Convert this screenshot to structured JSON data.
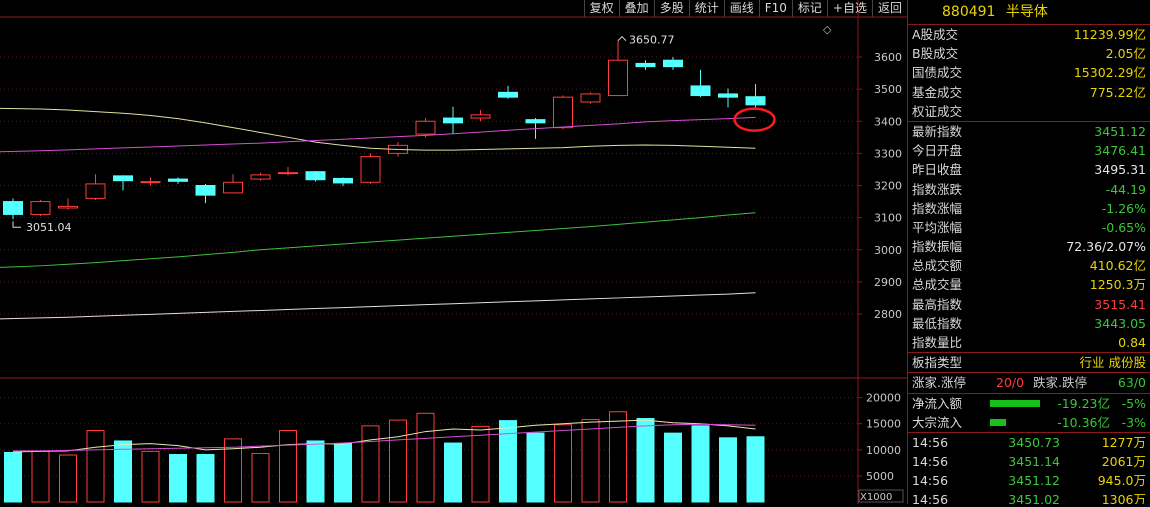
{
  "toolbar": {
    "buttons": [
      "复权",
      "叠加",
      "多股",
      "统计",
      "画线",
      "F10",
      "标记",
      "+自选",
      "返回"
    ]
  },
  "markers": {
    "high_label": "3650.77",
    "low_label": "3051.04",
    "diamond": "◇"
  },
  "price_axis": {
    "ticks": [
      "3600",
      "3500",
      "3400",
      "3300",
      "3200",
      "3100",
      "3000",
      "2900",
      "2800"
    ]
  },
  "volume_axis": {
    "ticks": [
      "20000",
      "15000",
      "10000",
      "5000"
    ],
    "unit": "X1000"
  },
  "colors": {
    "up": "#ff3c3c",
    "down": "#54ffff",
    "ma5": "#e8e8b0",
    "ma10": "#d24fd2",
    "ma20": "#e0e0a0",
    "ma60": "#3fc13f",
    "ma120": "#e0e0e0",
    "accent_yellow": "#e8d500",
    "gain_red": "#ff3c3c",
    "loss_green": "#38c838",
    "circle": "#ff1a1a"
  },
  "chart_data": {
    "type": "candlestick",
    "price_ylim": [
      2750,
      3650
    ],
    "volume_ylim": [
      0,
      23000
    ],
    "candles": [
      {
        "o": 3150,
        "c": 3110,
        "h": 3160,
        "l": 3095,
        "v": 9500
      },
      {
        "o": 3110,
        "c": 3150,
        "h": 3155,
        "l": 3105,
        "v": 9700
      },
      {
        "o": 3130,
        "c": 3135,
        "h": 3160,
        "l": 3125,
        "v": 9000
      },
      {
        "o": 3160,
        "c": 3205,
        "h": 3235,
        "l": 3155,
        "v": 13700
      },
      {
        "o": 3230,
        "c": 3215,
        "h": 3232,
        "l": 3185,
        "v": 11700
      },
      {
        "o": 3210,
        "c": 3212,
        "h": 3225,
        "l": 3200,
        "v": 9700
      },
      {
        "o": 3220,
        "c": 3213,
        "h": 3225,
        "l": 3205,
        "v": 9100
      },
      {
        "o": 3200,
        "c": 3170,
        "h": 3205,
        "l": 3145,
        "v": 9100
      },
      {
        "o": 3177,
        "c": 3210,
        "h": 3235,
        "l": 3175,
        "v": 12100
      },
      {
        "o": 3220,
        "c": 3233,
        "h": 3240,
        "l": 3215,
        "v": 9300
      },
      {
        "o": 3237,
        "c": 3240,
        "h": 3258,
        "l": 3232,
        "v": 13700
      },
      {
        "o": 3243,
        "c": 3218,
        "h": 3245,
        "l": 3212,
        "v": 11700
      },
      {
        "o": 3222,
        "c": 3208,
        "h": 3225,
        "l": 3198,
        "v": 11200
      },
      {
        "o": 3210,
        "c": 3290,
        "h": 3300,
        "l": 3205,
        "v": 14600
      },
      {
        "o": 3300,
        "c": 3325,
        "h": 3335,
        "l": 3290,
        "v": 15700
      },
      {
        "o": 3360,
        "c": 3400,
        "h": 3410,
        "l": 3350,
        "v": 17000
      },
      {
        "o": 3410,
        "c": 3395,
        "h": 3445,
        "l": 3360,
        "v": 11300
      },
      {
        "o": 3410,
        "c": 3420,
        "h": 3435,
        "l": 3400,
        "v": 14500
      },
      {
        "o": 3490,
        "c": 3475,
        "h": 3510,
        "l": 3470,
        "v": 15600
      },
      {
        "o": 3405,
        "c": 3395,
        "h": 3410,
        "l": 3345,
        "v": 13200
      },
      {
        "o": 3380,
        "c": 3475,
        "h": 3480,
        "l": 3375,
        "v": 14800
      },
      {
        "o": 3460,
        "c": 3485,
        "h": 3490,
        "l": 3455,
        "v": 15800
      },
      {
        "o": 3480,
        "c": 3590,
        "h": 3650.77,
        "l": 3478,
        "v": 17300
      },
      {
        "o": 3580,
        "c": 3570,
        "h": 3590,
        "l": 3560,
        "v": 16000
      },
      {
        "o": 3590,
        "c": 3570,
        "h": 3600,
        "l": 3560,
        "v": 13200
      },
      {
        "o": 3510,
        "c": 3480,
        "h": 3560,
        "l": 3475,
        "v": 14600
      },
      {
        "o": 3485,
        "c": 3475,
        "h": 3502,
        "l": 3443,
        "v": 12300
      },
      {
        "o": 3476.41,
        "c": 3451.12,
        "h": 3515.41,
        "l": 3443.05,
        "v": 12500
      }
    ],
    "ma_lines": [
      {
        "points": [
          3440,
          3438,
          3435,
          3430,
          3425,
          3418,
          3408,
          3395,
          3380,
          3365,
          3350,
          3335,
          3325,
          3316,
          3312,
          3310,
          3310,
          3312,
          3314,
          3316,
          3318,
          3322,
          3325,
          3326,
          3325,
          3322,
          3319,
          3316
        ]
      },
      {
        "points": [
          3305,
          3308,
          3311,
          3314,
          3317,
          3320,
          3323,
          3326,
          3329,
          3332,
          3336,
          3340,
          3344,
          3348,
          3352,
          3356,
          3361,
          3366,
          3372,
          3377,
          3382,
          3387,
          3392,
          3398,
          3402,
          3405,
          3408,
          3412
        ]
      },
      {
        "points": [
          2945,
          2950,
          2955,
          2960,
          2966,
          2972,
          2978,
          2985,
          2992,
          3000,
          3006,
          3012,
          3018,
          3024,
          3030,
          3036,
          3042,
          3048,
          3054,
          3060,
          3066,
          3072,
          3079,
          3086,
          3093,
          3100,
          3108,
          3115
        ]
      },
      {
        "points": [
          2785,
          2788,
          2790,
          2793,
          2796,
          2799,
          2802,
          2805,
          2808,
          2811,
          2814,
          2817,
          2820,
          2823,
          2826,
          2829,
          2832,
          2835,
          2838,
          2841,
          2844,
          2847,
          2850,
          2853,
          2856,
          2859,
          2862,
          2866
        ]
      }
    ],
    "vol_ma_lines": [
      {
        "points": [
          9600,
          9700,
          9800,
          10500,
          11000,
          11200,
          10800,
          10000,
          10200,
          10500,
          11000,
          11200,
          11100,
          11900,
          12500,
          13500,
          14000,
          13800,
          14200,
          14700,
          15000,
          15300,
          15500,
          15700,
          15200,
          15000,
          14600,
          14000
        ]
      },
      {
        "points": [
          9800,
          9800,
          9900,
          10000,
          10100,
          10200,
          10300,
          10400,
          10500,
          10700,
          10900,
          11100,
          11300,
          11600,
          11900,
          12200,
          12500,
          12800,
          13100,
          13400,
          13700,
          14000,
          14300,
          14600,
          14800,
          14900,
          14800,
          14700
        ]
      }
    ]
  },
  "panel": {
    "code": "880491",
    "name": "半导体",
    "rows1": [
      {
        "label": "A股成交",
        "value": "11239.99亿",
        "cls": "yellow"
      },
      {
        "label": "B股成交",
        "value": "2.05亿",
        "cls": "yellow"
      },
      {
        "label": "国债成交",
        "value": "15302.29亿",
        "cls": "yellow"
      },
      {
        "label": "基金成交",
        "value": "775.22亿",
        "cls": "yellow"
      },
      {
        "label": "权证成交",
        "value": "",
        "cls": "yellow"
      }
    ],
    "rows2": [
      {
        "label": "最新指数",
        "value": "3451.12",
        "cls": "down"
      },
      {
        "label": "今日开盘",
        "value": "3476.41",
        "cls": "down"
      },
      {
        "label": "昨日收盘",
        "value": "3495.31",
        "cls": "neutral"
      },
      {
        "label": "指数涨跌",
        "value": "-44.19",
        "cls": "down"
      },
      {
        "label": "指数涨幅",
        "value": "-1.26%",
        "cls": "down"
      },
      {
        "label": "平均涨幅",
        "value": "-0.65%",
        "cls": "down"
      },
      {
        "label": "指数振幅",
        "value": "72.36/2.07%",
        "cls": "neutral"
      },
      {
        "label": "总成交额",
        "value": "410.62亿",
        "cls": "yellow"
      },
      {
        "label": "总成交量",
        "value": "1250.3万",
        "cls": "yellow"
      },
      {
        "label": "最高指数",
        "value": "3515.41",
        "cls": "up"
      },
      {
        "label": "最低指数",
        "value": "3443.05",
        "cls": "down"
      },
      {
        "label": "指数量比",
        "value": "0.84",
        "cls": "yellow"
      }
    ],
    "sector": {
      "label": "板指类型",
      "value": "行业 成份股"
    },
    "breadth": {
      "label": "涨家.涨停",
      "up_value": "20/0",
      "label2": "跌家.跌停",
      "down_value": "63/0"
    },
    "flows": [
      {
        "label": "净流入额",
        "value": "-19.23亿",
        "pct": "-5%",
        "bar": 0.8
      },
      {
        "label": "大宗流入",
        "value": "-10.36亿",
        "pct": "-3%",
        "bar": 0.25
      }
    ],
    "ticks": [
      {
        "time": "14:56",
        "price": "3450.73",
        "vol": "1277万"
      },
      {
        "time": "14:56",
        "price": "3451.14",
        "vol": "2061万"
      },
      {
        "time": "14:56",
        "price": "3451.12",
        "vol": "945.0万"
      },
      {
        "time": "14:56",
        "price": "3451.02",
        "vol": "1306万"
      }
    ]
  }
}
